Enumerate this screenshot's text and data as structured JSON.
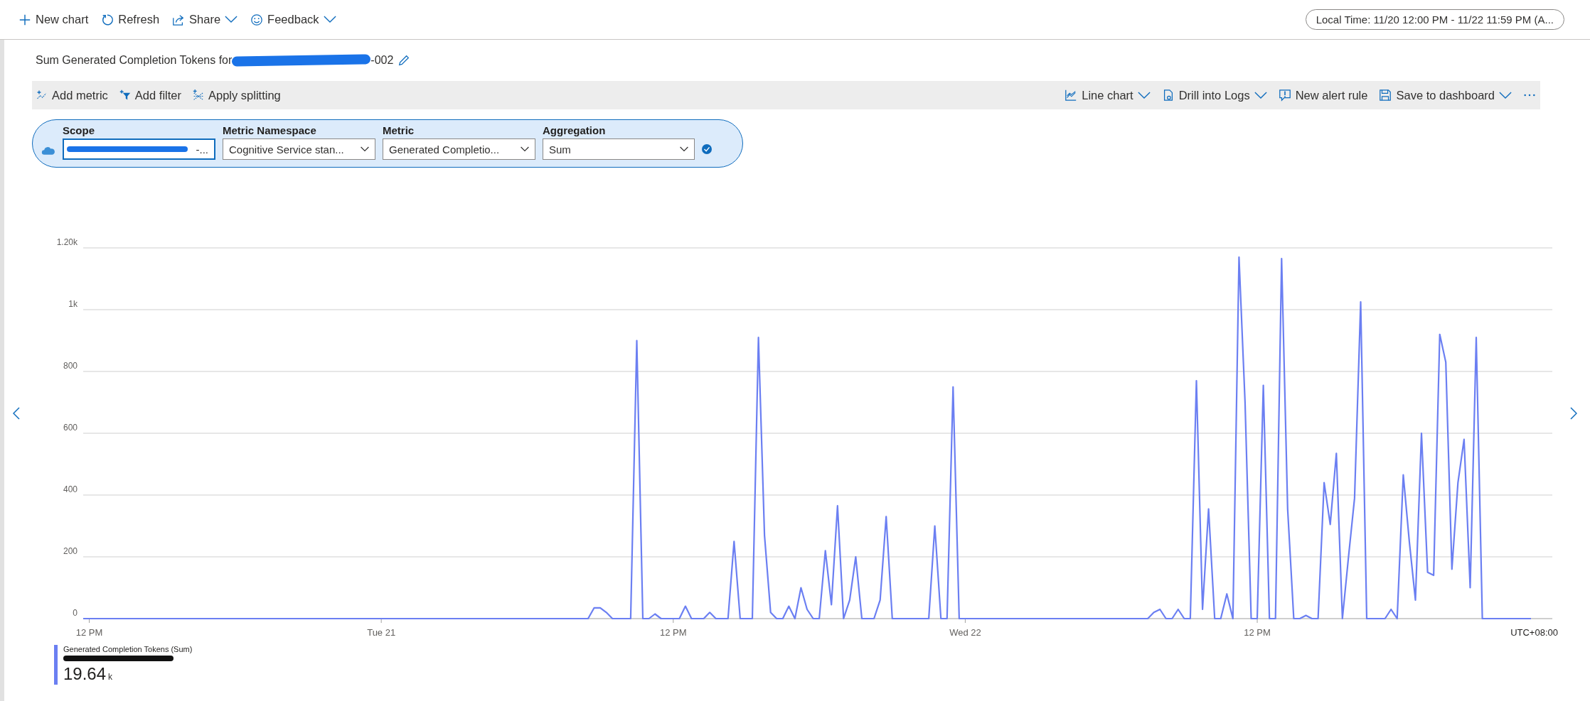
{
  "toolbar": {
    "items": [
      {
        "label": "New chart",
        "kind": "plus",
        "dropdown": false
      },
      {
        "label": "Refresh",
        "kind": "refresh",
        "dropdown": false
      },
      {
        "label": "Share",
        "kind": "share",
        "dropdown": true
      },
      {
        "label": "Feedback",
        "kind": "smiley",
        "dropdown": true
      }
    ],
    "time_range": "Local Time: 11/20 12:00 PM - 11/22 11:59 PM (A..."
  },
  "chart_title": {
    "prefix": "Sum Generated Completion Tokens for",
    "suffix": "-002"
  },
  "command_bar": {
    "left": [
      {
        "label": "Add metric",
        "kind": "metric",
        "dropdown": false
      },
      {
        "label": "Add filter",
        "kind": "filter",
        "dropdown": false
      },
      {
        "label": "Apply splitting",
        "kind": "split",
        "dropdown": false
      }
    ],
    "right": [
      {
        "label": "Line chart",
        "kind": "linechart",
        "dropdown": true
      },
      {
        "label": "Drill into Logs",
        "kind": "logs",
        "dropdown": true
      },
      {
        "label": "New alert rule",
        "kind": "alert",
        "dropdown": false
      },
      {
        "label": "Save to dashboard",
        "kind": "save",
        "dropdown": true
      }
    ]
  },
  "metric_selector": {
    "fields": [
      {
        "label": "Scope",
        "value": "-...",
        "kind": "text"
      },
      {
        "label": "Metric Namespace",
        "value": "Cognitive Service stan...",
        "kind": "dropdown"
      },
      {
        "label": "Metric",
        "value": "Generated Completio...",
        "kind": "dropdown"
      },
      {
        "label": "Aggregation",
        "value": "Sum",
        "kind": "dropdown"
      }
    ]
  },
  "chart": {
    "timezone": "UTC+08:00",
    "chart_data": {
      "type": "line",
      "grid": true,
      "ylim": [
        0,
        1200
      ],
      "yticks": [
        0,
        200,
        400,
        600,
        800,
        {
          "value": 1000,
          "label": "1k"
        },
        {
          "value": 1200,
          "label": "1.20k"
        }
      ],
      "categories": [
        null,
        "12 PM",
        null,
        null,
        null,
        null,
        null,
        null,
        null,
        null,
        null,
        null,
        null,
        null,
        null,
        null,
        null,
        null,
        null,
        null,
        null,
        null,
        null,
        null,
        null,
        null,
        null,
        null,
        null,
        null,
        null,
        null,
        null,
        null,
        null,
        null,
        null,
        null,
        null,
        null,
        null,
        null,
        null,
        null,
        null,
        null,
        null,
        null,
        null,
        "Tue 21",
        null,
        null,
        null,
        null,
        null,
        null,
        null,
        null,
        null,
        null,
        null,
        null,
        null,
        null,
        null,
        null,
        null,
        null,
        null,
        null,
        null,
        null,
        null,
        null,
        null,
        null,
        null,
        null,
        null,
        null,
        null,
        null,
        null,
        null,
        null,
        null,
        null,
        null,
        null,
        null,
        null,
        null,
        null,
        null,
        null,
        null,
        null,
        "12 PM",
        null,
        null,
        null,
        null,
        null,
        null,
        null,
        null,
        null,
        null,
        null,
        null,
        null,
        null,
        null,
        null,
        null,
        null,
        null,
        null,
        null,
        null,
        null,
        null,
        null,
        null,
        null,
        null,
        null,
        null,
        null,
        null,
        null,
        null,
        null,
        null,
        null,
        null,
        null,
        null,
        null,
        null,
        null,
        null,
        null,
        null,
        null,
        "Wed 22",
        null,
        null,
        null,
        null,
        null,
        null,
        null,
        null,
        null,
        null,
        null,
        null,
        null,
        null,
        null,
        null,
        null,
        null,
        null,
        null,
        null,
        null,
        null,
        null,
        null,
        null,
        null,
        null,
        null,
        null,
        null,
        null,
        null,
        null,
        null,
        null,
        null,
        null,
        null,
        null,
        null,
        null,
        null,
        null,
        null,
        null,
        null,
        "12 PM",
        null,
        null,
        null,
        null,
        null,
        null,
        null,
        null,
        null,
        null,
        null,
        null,
        null,
        null,
        null,
        null,
        null,
        null,
        null,
        null,
        null,
        null,
        null,
        null,
        null,
        null,
        null,
        null,
        null,
        null,
        null,
        null,
        null,
        null,
        null,
        null,
        null,
        null,
        null,
        null,
        null,
        null,
        null,
        null,
        null
      ],
      "series": [
        {
          "name": "Generated Completion Tokens (Sum)",
          "color": "#6b7ff2",
          "values": [
            0,
            0,
            0,
            0,
            0,
            0,
            0,
            0,
            0,
            0,
            0,
            0,
            0,
            0,
            0,
            0,
            0,
            0,
            0,
            0,
            0,
            0,
            0,
            0,
            0,
            0,
            0,
            0,
            0,
            0,
            0,
            0,
            0,
            0,
            0,
            0,
            0,
            0,
            0,
            0,
            0,
            0,
            0,
            0,
            0,
            0,
            0,
            0,
            0,
            0,
            0,
            0,
            0,
            0,
            0,
            0,
            0,
            0,
            0,
            0,
            0,
            0,
            0,
            0,
            0,
            0,
            0,
            0,
            0,
            0,
            0,
            0,
            0,
            0,
            0,
            0,
            0,
            0,
            0,
            0,
            0,
            0,
            0,
            0,
            35,
            35,
            20,
            0,
            0,
            0,
            0,
            900,
            0,
            0,
            15,
            0,
            0,
            0,
            0,
            40,
            0,
            0,
            0,
            20,
            0,
            0,
            0,
            250,
            0,
            0,
            0,
            910,
            270,
            20,
            0,
            0,
            40,
            0,
            100,
            30,
            0,
            0,
            220,
            45,
            365,
            0,
            60,
            200,
            0,
            0,
            0,
            60,
            330,
            0,
            0,
            0,
            0,
            0,
            0,
            0,
            300,
            0,
            0,
            750,
            0,
            0,
            0,
            0,
            0,
            0,
            0,
            0,
            0,
            0,
            0,
            0,
            0,
            0,
            0,
            0,
            0,
            0,
            0,
            0,
            0,
            0,
            0,
            0,
            0,
            0,
            0,
            0,
            0,
            0,
            0,
            0,
            20,
            30,
            0,
            0,
            30,
            0,
            0,
            770,
            30,
            355,
            0,
            0,
            80,
            0,
            1170,
            700,
            0,
            0,
            755,
            0,
            0,
            1165,
            355,
            0,
            0,
            10,
            0,
            0,
            440,
            305,
            535,
            0,
            200,
            390,
            1025,
            0,
            0,
            0,
            0,
            30,
            0,
            465,
            250,
            60,
            600,
            150,
            140,
            920,
            830,
            160,
            440,
            580,
            100,
            910,
            0,
            0,
            0,
            0,
            0,
            0,
            0,
            0,
            0
          ]
        }
      ]
    }
  },
  "legend": {
    "value": "19.64",
    "unit": "k"
  }
}
